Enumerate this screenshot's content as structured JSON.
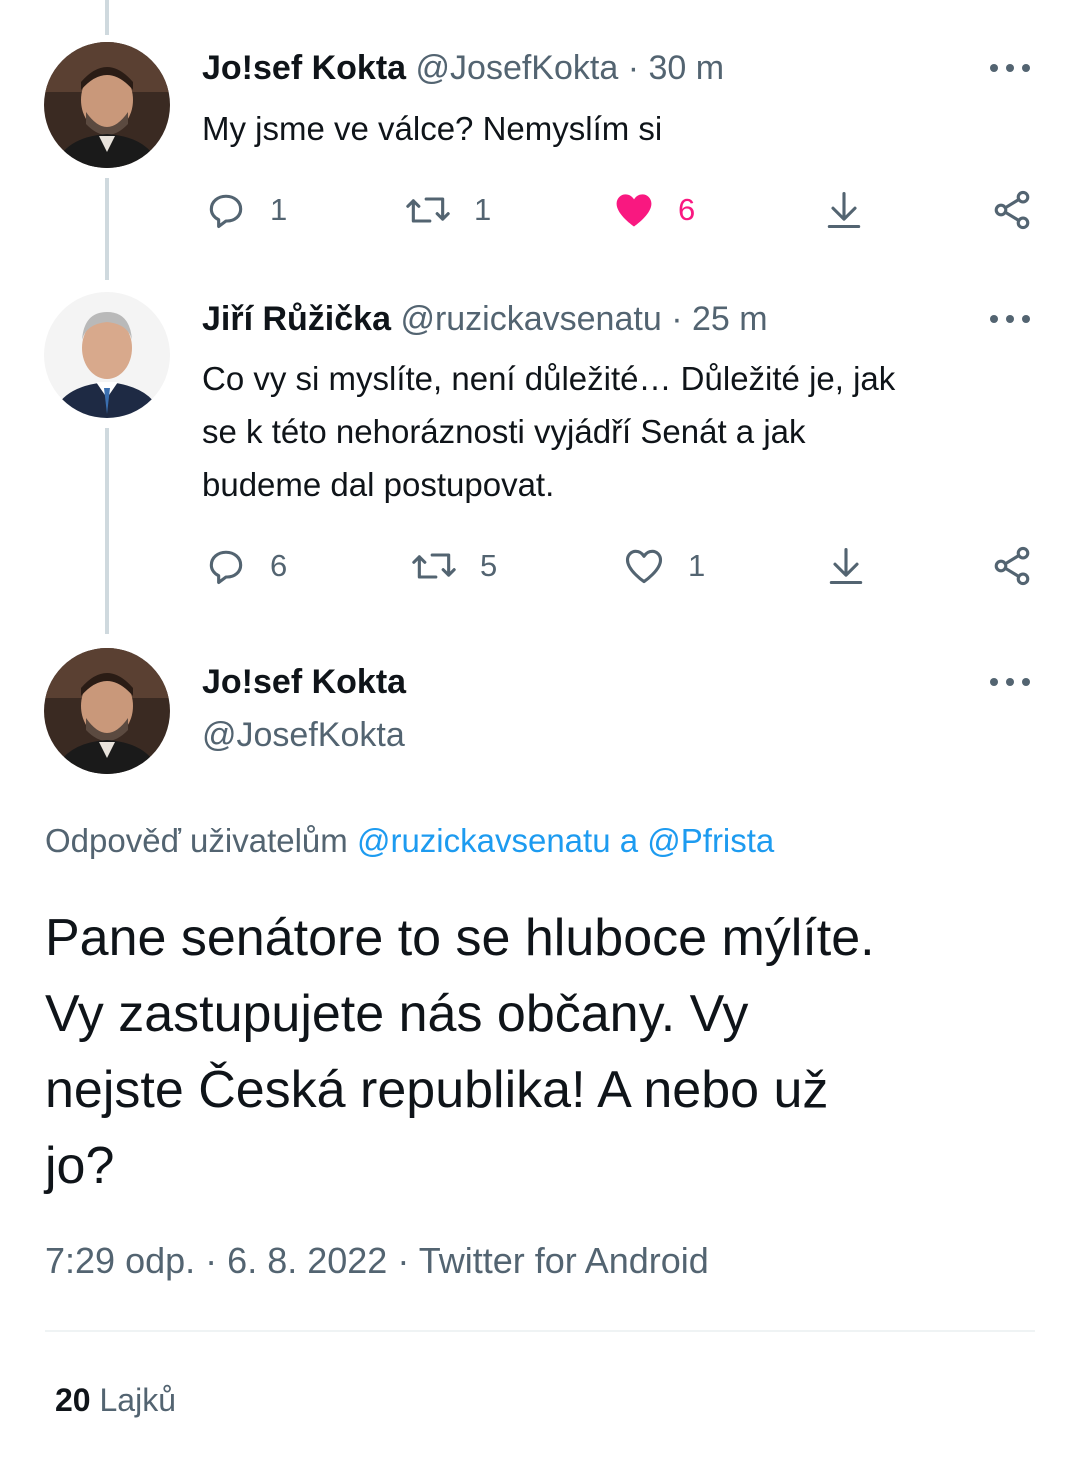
{
  "tweet1": {
    "author_name": "Jo!sef Kokta",
    "handle": "@JosefKokta",
    "separator": "·",
    "time": "30 m",
    "text": "My jsme ve válce? Nemyslím si",
    "replies": "1",
    "retweets": "1",
    "likes": "6",
    "liked": true
  },
  "tweet2": {
    "author_name": "Jiří Růžička",
    "handle": "@ruzickavsenatu",
    "separator": "·",
    "time": "25 m",
    "text_lines": [
      "Co vy si myslíte,  není důležité… Důležité je, jak",
      "se k této nehoráznosti vyjádří Senát a jak",
      "budeme dal postupovat."
    ],
    "replies": "6",
    "retweets": "5",
    "likes": "1",
    "liked": false
  },
  "main_tweet": {
    "author_name": "Jo!sef Kokta",
    "handle": "@JosefKokta",
    "reply_prefix": "Odpověď uživatelům",
    "reply_mention1": "@ruzickavsenatu",
    "reply_conj": "a",
    "reply_mention2": "@Pfrista",
    "text_lines": [
      "Pane senátore to se hluboce mýlíte.",
      "Vy zastupujete nás občany. Vy",
      "nejste Česká republika! A nebo už",
      "jo?"
    ],
    "time": "7:29 odp.",
    "separator": "·",
    "date": "6. 8. 2022",
    "source": "Twitter for Android",
    "likes_count": "20",
    "likes_label": "Lajků"
  },
  "colors": {
    "text": "#0f1419",
    "muted": "#536471",
    "mention": "#1d9bf0",
    "like": "#f91880",
    "thread_line": "#cfd9de"
  },
  "icons": {
    "reply": "reply-icon",
    "retweet": "retweet-icon",
    "like": "heart-icon",
    "download": "download-icon",
    "share": "share-icon",
    "more": "more-icon"
  }
}
